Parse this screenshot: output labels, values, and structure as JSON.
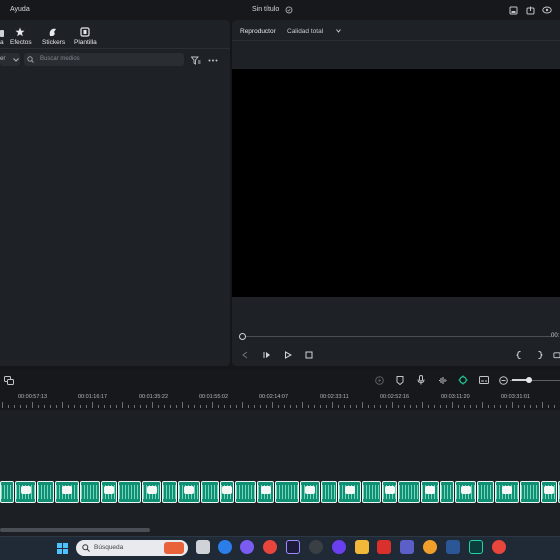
{
  "menu": {
    "help": "Ayuda"
  },
  "title": {
    "project_name": "Sin título"
  },
  "media_tabs": [
    {
      "label": "Efectos",
      "icon": "effects-icon"
    },
    {
      "label": "Stickers",
      "icon": "stickers-icon"
    },
    {
      "label": "Plantilla",
      "icon": "template-icon"
    }
  ],
  "media_search": {
    "placeholder": "Buscar medios",
    "filter_partial": "er"
  },
  "player": {
    "label": "Reproductor",
    "quality": "Calidad total",
    "time_partial": "00:"
  },
  "ruler": {
    "timestamps": [
      "00:00:57:13",
      "00:01:16:17",
      "00:01:35:22",
      "00:01:55:02",
      "00:02:14:07",
      "00:02:33:11",
      "00:02:52:16",
      "00:03:11:20",
      "00:03:31:01"
    ]
  },
  "taskbar": {
    "search_placeholder": "Búsqueda"
  },
  "colors": {
    "accent_green": "#118f74",
    "background": "#141619",
    "panel": "#1e2125"
  }
}
